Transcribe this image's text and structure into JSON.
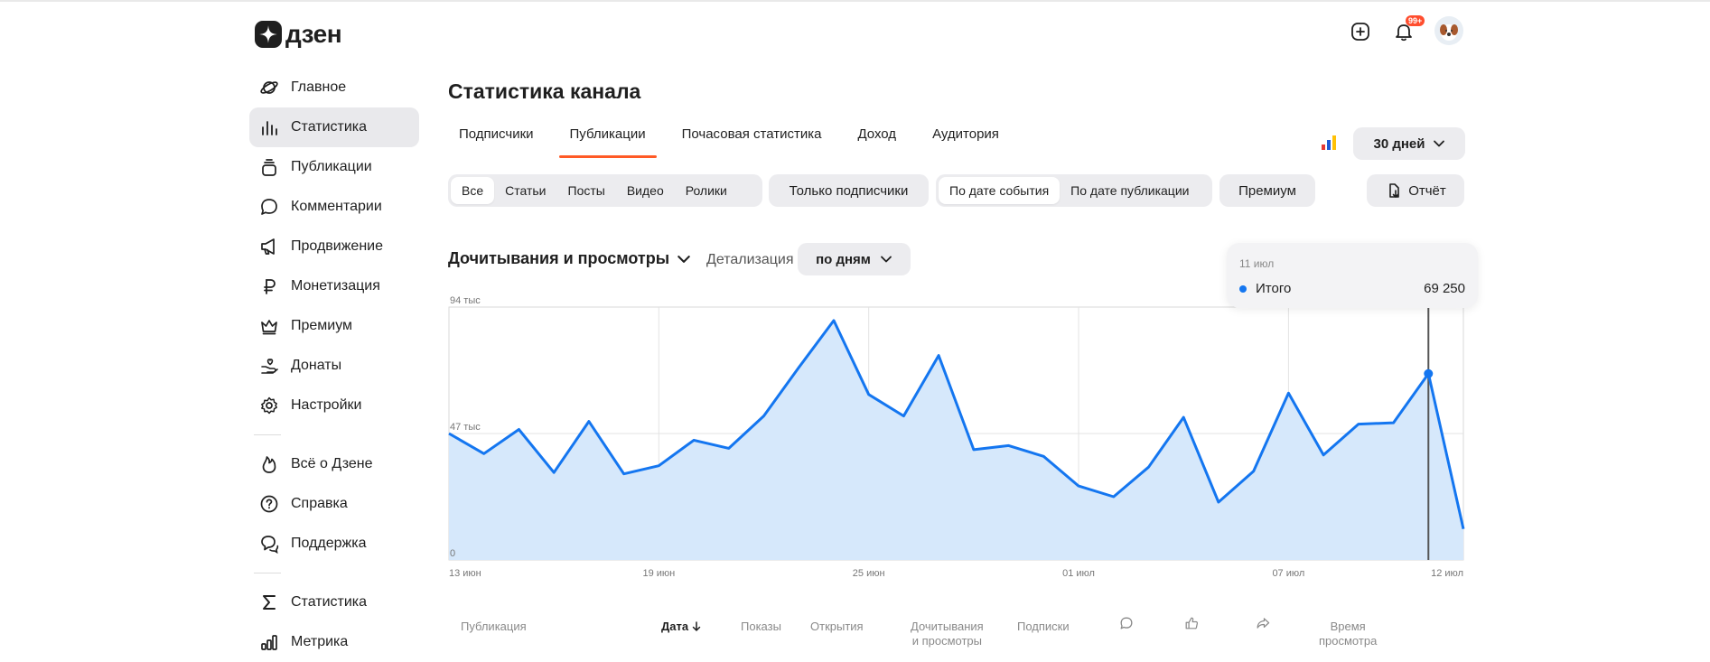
{
  "app": {
    "logo_text": "дзен"
  },
  "header": {
    "notifications_badge": "99+"
  },
  "sidebar": {
    "items": [
      {
        "label": "Главное",
        "icon": "planet-icon"
      },
      {
        "label": "Статистика",
        "icon": "bar-chart-icon",
        "active": true
      },
      {
        "label": "Публикации",
        "icon": "stack-icon"
      },
      {
        "label": "Комментарии",
        "icon": "comment-icon"
      },
      {
        "label": "Продвижение",
        "icon": "megaphone-icon"
      },
      {
        "label": "Монетизация",
        "icon": "ruble-icon"
      },
      {
        "label": "Премиум",
        "icon": "crown-icon"
      },
      {
        "label": "Донаты",
        "icon": "donate-hand-icon"
      },
      {
        "label": "Настройки",
        "icon": "gear-icon"
      }
    ],
    "secondary": [
      {
        "label": "Всё о Дзене",
        "icon": "flame-icon"
      },
      {
        "label": "Справка",
        "icon": "help-icon"
      },
      {
        "label": "Поддержка",
        "icon": "support-icon"
      }
    ],
    "tertiary": [
      {
        "label": "Статистика",
        "icon": "sigma-icon"
      },
      {
        "label": "Метрика",
        "icon": "metrika-icon"
      }
    ]
  },
  "main": {
    "title": "Статистика канала",
    "tabs": [
      "Подписчики",
      "Публикации",
      "Почасовая статистика",
      "Доход",
      "Аудитория"
    ],
    "active_tab": "Публикации",
    "period": "30 дней",
    "type_filters": [
      "Все",
      "Статьи",
      "Посты",
      "Видео",
      "Ролики"
    ],
    "subscribers_only": "Только подписчики",
    "date_filters": [
      "По дате события",
      "По дате публикации"
    ],
    "premium": "Премиум",
    "report": "Отчёт",
    "metric": "Дочитывания и просмотры",
    "detail_label": "Детализация",
    "detail_value": "по дням"
  },
  "tooltip": {
    "date": "11 июл",
    "series": "Итого",
    "value": "69 250"
  },
  "chart_data": {
    "type": "area",
    "title": "",
    "ylabels": [
      "94 тыс",
      "47 тыс",
      "0"
    ],
    "ylim": [
      0,
      94000
    ],
    "xticks": [
      "13 июн",
      "19 июн",
      "25 июн",
      "01 июл",
      "07 июл",
      "12 июл"
    ],
    "x": [
      "13 июн",
      "14 июн",
      "15 июн",
      "16 июн",
      "17 июн",
      "18 июн",
      "19 июн",
      "20 июн",
      "21 июн",
      "22 июн",
      "23 июн",
      "24 июн",
      "25 июн",
      "26 июн",
      "27 июн",
      "28 июн",
      "29 июн",
      "30 июн",
      "01 июл",
      "02 июл",
      "03 июл",
      "04 июл",
      "05 июл",
      "06 июл",
      "07 июл",
      "08 июл",
      "09 июл",
      "10 июл",
      "11 июл",
      "12 июл"
    ],
    "series": [
      {
        "name": "Итого",
        "color": "#1476f0",
        "fill": "#d6e8fb",
        "values": [
          47000,
          39500,
          48500,
          32500,
          51500,
          32000,
          35000,
          44500,
          41500,
          53500,
          71500,
          89000,
          61500,
          53500,
          76000,
          41000,
          42500,
          38500,
          27500,
          23500,
          34500,
          53000,
          21500,
          33000,
          62000,
          39000,
          50500,
          51000,
          69250,
          11500
        ]
      }
    ],
    "highlight_index": 28,
    "grid": true
  },
  "table_header": [
    {
      "label": "Публикация"
    },
    {
      "label": "Дата"
    },
    {
      "label": "Показы"
    },
    {
      "label": "Открытия"
    },
    {
      "label": "Дочитывания\nи просмотры"
    },
    {
      "label": "Подписки"
    },
    {
      "icon": "comment-icon"
    },
    {
      "icon": "like-icon"
    },
    {
      "icon": "share-icon"
    },
    {
      "label": "Время\nпросмотра"
    }
  ]
}
